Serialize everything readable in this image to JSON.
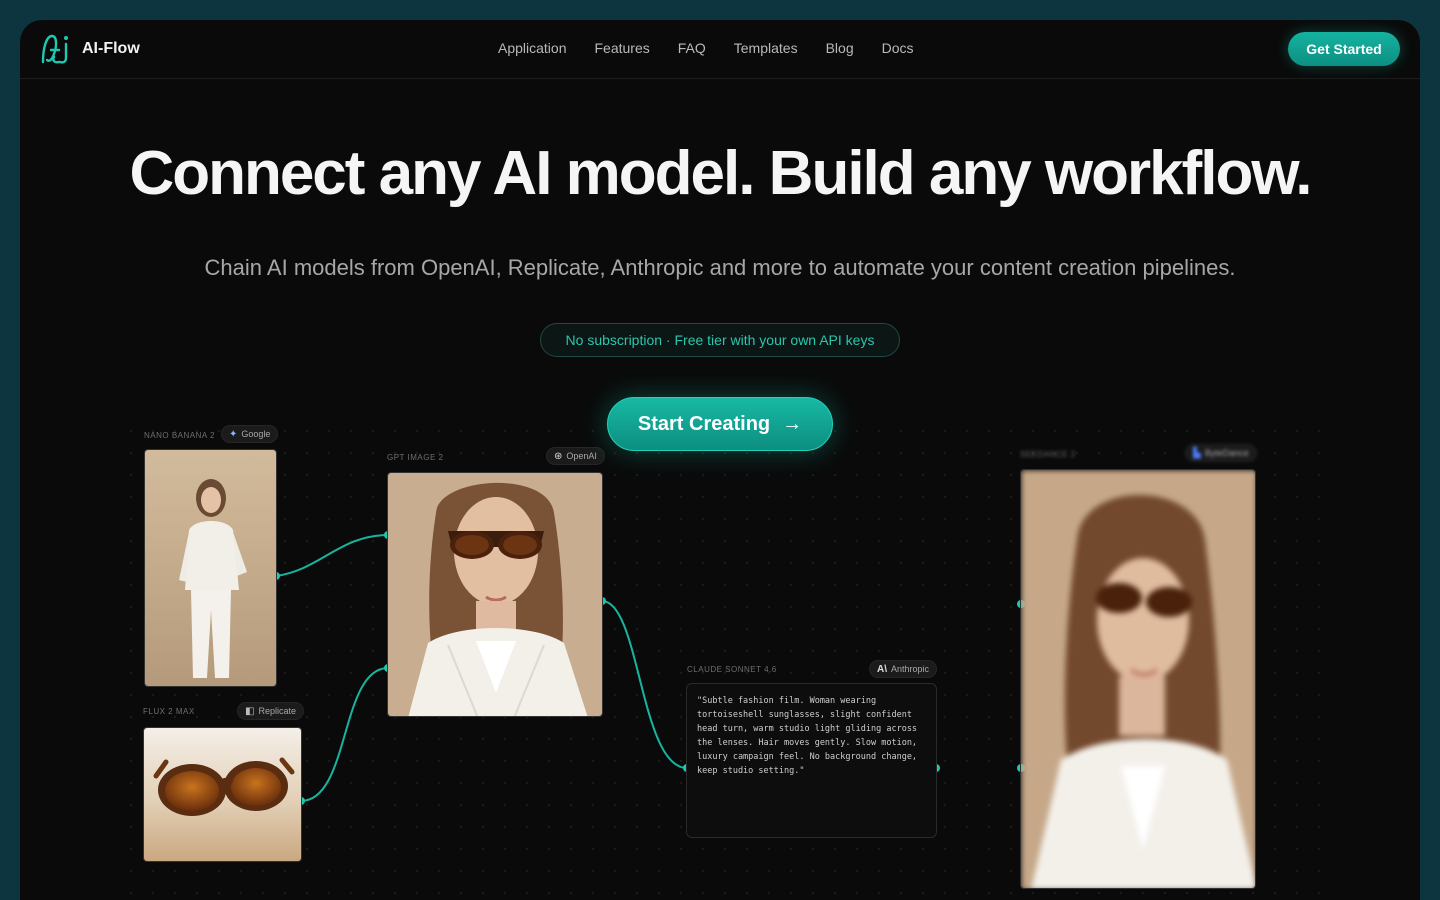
{
  "brand": {
    "name": "AI-Flow",
    "accent": "#14b8a6"
  },
  "nav": {
    "links": [
      "Application",
      "Features",
      "FAQ",
      "Templates",
      "Blog",
      "Docs"
    ],
    "cta": "Get Started"
  },
  "hero": {
    "title": "Connect any AI model. Build any workflow.",
    "subtitle": "Chain AI models from OpenAI, Replicate, Anthropic and more to automate your content creation pipelines.",
    "pill": "No subscription · Free tier with your own API keys",
    "cta": "Start Creating"
  },
  "nodes": {
    "nano": {
      "label": "NANO BANANA 2",
      "provider": "Google"
    },
    "gpt": {
      "label": "GPT IMAGE 2",
      "provider": "OpenAI"
    },
    "flux": {
      "label": "FLUX 2 MAX",
      "provider": "Replicate"
    },
    "claude": {
      "label": "CLAUDE SONNET 4.6",
      "provider": "Anthropic",
      "prompt": "\"Subtle fashion film. Woman wearing tortoiseshell sunglasses, slight confident head turn, warm studio light gliding across the lenses. Hair moves gently. Slow motion, luxury campaign feel. No background change, keep studio setting.\""
    },
    "seedance": {
      "label": "SEEDANCE 2",
      "provider": "ByteDance"
    }
  }
}
